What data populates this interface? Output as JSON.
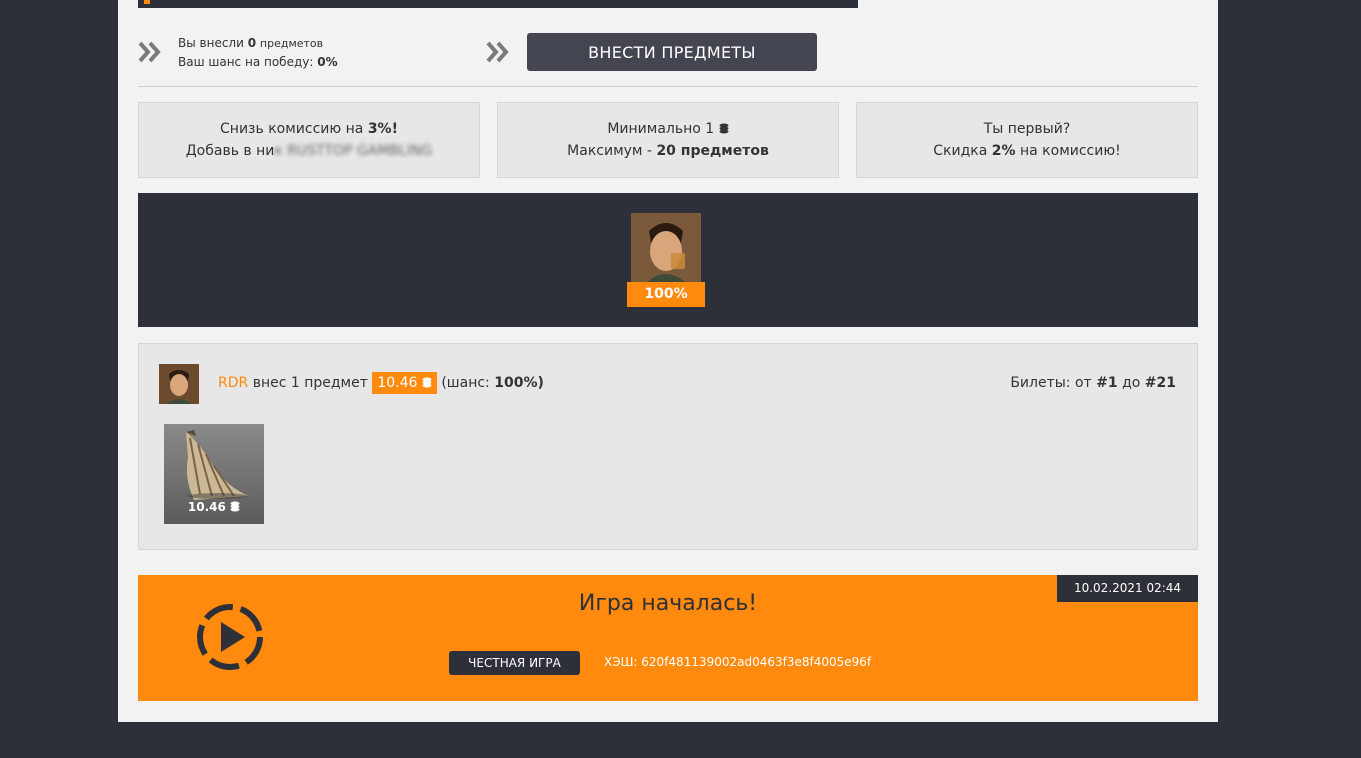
{
  "deposit": {
    "line1_prefix": "Вы внесли",
    "items_count": "0",
    "line1_suffix": "предметов",
    "line2_prefix": "Ваш шанс на победу:",
    "chance": "0%",
    "button_label": "ВНЕСТИ ПРЕДМЕТЫ"
  },
  "info_cards": [
    {
      "line1_prefix": "Снизь комиссию на",
      "line1_bold": "3%!",
      "line2_prefix": "Добавь в ни",
      "line2_blurred": "к RUSTTOP GAMBLING"
    },
    {
      "line1_prefix": "Минимально 1",
      "line2_prefix": "Максимум -",
      "line2_bold": "20 предметов"
    },
    {
      "line1_prefix": "Ты первый?",
      "line2_prefix": "Скидка",
      "line2_bold": "2%",
      "line2_suffix": "на комиссию!"
    }
  ],
  "players": [
    {
      "chance": "100%"
    }
  ],
  "bet": {
    "username": "RDR",
    "action": "внес 1 предмет",
    "amount": "10.46",
    "chance_prefix": "(шанс:",
    "chance": "100%)",
    "tickets_prefix": "Билеты: от",
    "ticket_from": "#1",
    "tickets_mid": "до",
    "ticket_to": "#21",
    "item_price": "10.46"
  },
  "game": {
    "date": "10.02.2021 02:44",
    "title": "Игра началась!",
    "fair_button": "ЧЕСТНАЯ ИГРА",
    "hash_label": "ХЭШ: 620f481139002ad0463f3e8f4005e96f"
  },
  "colors": {
    "accent": "#ff8a0d",
    "dark": "#2d3038",
    "panel": "#e7e7e7"
  },
  "icons": {
    "chevron": "double-chevron-right-icon",
    "coin": "coins-stack-icon",
    "play": "play-circle-icon"
  }
}
